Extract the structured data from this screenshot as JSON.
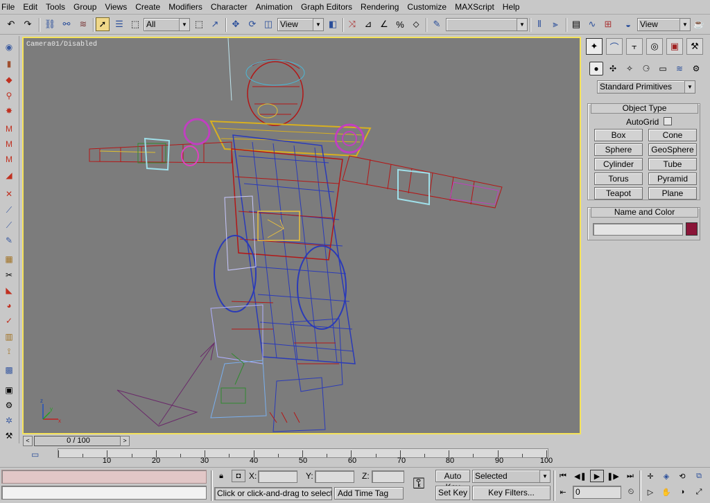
{
  "menu": [
    "File",
    "Edit",
    "Tools",
    "Group",
    "Views",
    "Create",
    "Modifiers",
    "Character",
    "Animation",
    "Graph Editors",
    "Rendering",
    "Customize",
    "MAXScript",
    "Help"
  ],
  "toolbar": {
    "selection_filter": "All",
    "ref_coord_system": "View",
    "named_selection_set": "",
    "render_type": "View"
  },
  "viewport": {
    "label": "Camera01/Disabled",
    "active_border_color": "#f5e35a",
    "background_color": "#7c7c7c"
  },
  "time_slider": {
    "position_label": "0 / 100",
    "prev_icon": "chevron-left-icon",
    "next_icon": "chevron-right-icon"
  },
  "track_bar": {
    "labels": [
      "10",
      "20",
      "30",
      "40",
      "50",
      "60",
      "70",
      "80",
      "90",
      "100"
    ]
  },
  "command_panel": {
    "tabs": [
      "create-icon",
      "modify-icon",
      "hierarchy-icon",
      "motion-icon",
      "display-icon",
      "utilities-icon"
    ],
    "category_icons": [
      "geometry-icon",
      "shapes-icon",
      "lights-icon",
      "cameras-icon",
      "helpers-icon",
      "spacewarps-icon",
      "systems-icon"
    ],
    "category_dropdown": "Standard Primitives",
    "object_type_title": "Object Type",
    "autogrid_label": "AutoGrid",
    "primitives": [
      "Box",
      "Cone",
      "Sphere",
      "GeoSphere",
      "Cylinder",
      "Tube",
      "Torus",
      "Pyramid",
      "Teapot",
      "Plane"
    ],
    "name_color_title": "Name and Color",
    "object_name": "",
    "object_color": "#8a1538"
  },
  "status": {
    "maxscript_listener_top": "",
    "maxscript_listener_bottom": "",
    "x_label": "X:",
    "y_label": "Y:",
    "z_label": "Z:",
    "x_value": "",
    "y_value": "",
    "z_value": "",
    "prompt": "Click or click-and-drag to select obj",
    "add_time_tag": "Add Time Tag",
    "auto_key": "Auto Key",
    "set_key": "Set Key",
    "key_mode": "Selected",
    "key_filters": "Key Filters...",
    "current_frame": "0"
  }
}
